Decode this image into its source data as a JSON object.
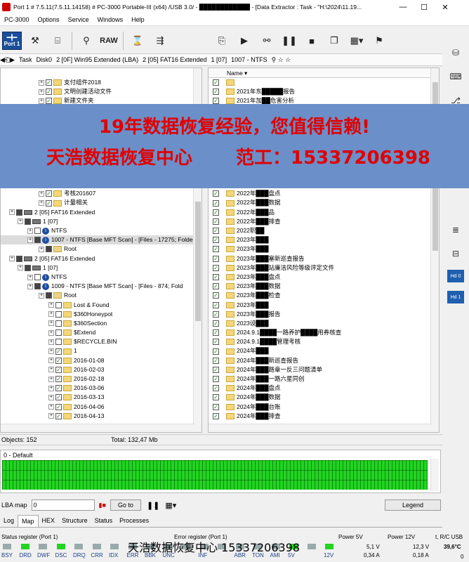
{
  "window": {
    "title": "Port 1 # 7.5.11(7.5.11.14158) # PC-3000 Portable-III (x64) /USB 3.0/ - ████████████ - [Data Extractor : Task - \"H:\\2024\\11.19...",
    "min": "—",
    "max": "☐",
    "close": "✕"
  },
  "menu": {
    "app": "PC-3000",
    "items": [
      "Options",
      "Service",
      "Windows",
      "Help"
    ]
  },
  "toolbar": {
    "port": "Port 1",
    "raw": "RAW"
  },
  "breadcrumb": {
    "task": "Task",
    "disk": "Disk0",
    "part1": "2 [0F] Win95 Extended  (LBA)",
    "part2": "2 [05] FAT16 Extended",
    "part3": "1 [07]",
    "part4": "1007 - NTFS"
  },
  "tree": [
    {
      "indent": 54,
      "cb": "check",
      "icon": "folder",
      "label": "支付组件2018"
    },
    {
      "indent": 54,
      "cb": "check",
      "icon": "folder",
      "label": "文明创建活动文件"
    },
    {
      "indent": 54,
      "cb": "check",
      "icon": "folder",
      "label": "新建文件夹"
    },
    {
      "indent": 54,
      "cb": "check",
      "icon": "folder",
      "label": ""
    },
    {
      "indent": 54,
      "cb": "check",
      "icon": "folder",
      "label": ""
    },
    {
      "indent": 54,
      "cb": "check",
      "icon": "folder",
      "label": ""
    },
    {
      "indent": 54,
      "cb": "check",
      "icon": "folder",
      "label": ""
    },
    {
      "indent": 54,
      "cb": "check",
      "icon": "folder",
      "label": ""
    },
    {
      "indent": 54,
      "cb": "check",
      "icon": "folder",
      "label": ""
    },
    {
      "indent": 54,
      "cb": "check",
      "icon": "folder",
      "label": ""
    },
    {
      "indent": 54,
      "cb": "check",
      "icon": "folder",
      "label": ""
    },
    {
      "indent": 54,
      "cb": "check",
      "icon": "folder",
      "label": ""
    },
    {
      "indent": 54,
      "cb": "check",
      "icon": "folder",
      "label": "考核201607"
    },
    {
      "indent": 54,
      "cb": "check",
      "icon": "folder",
      "label": "计量相关"
    },
    {
      "indent": 12,
      "cb": "part",
      "icon": "hdd",
      "label": "2 [05] FAT16 Extended"
    },
    {
      "indent": 24,
      "cb": "part",
      "icon": "hdd",
      "label": "1 [07]"
    },
    {
      "indent": 38,
      "cb": "none",
      "icon": "info",
      "label": "NTFS"
    },
    {
      "indent": 38,
      "cb": "part",
      "icon": "info",
      "label": "1007 - NTFS [Base MFT Scan] - [Files - 17275; Folde",
      "sel": true
    },
    {
      "indent": 54,
      "cb": "part",
      "icon": "root",
      "label": "Root"
    },
    {
      "indent": 12,
      "cb": "part",
      "icon": "hdd",
      "label": "2 [05] FAT16 Extended"
    },
    {
      "indent": 24,
      "cb": "part",
      "icon": "hdd",
      "label": "1 [07]"
    },
    {
      "indent": 38,
      "cb": "none",
      "icon": "info",
      "label": "NTFS"
    },
    {
      "indent": 38,
      "cb": "part",
      "icon": "info",
      "label": "1009 - NTFS [Base MFT Scan] - [Files - 874; Fold"
    },
    {
      "indent": 54,
      "cb": "part",
      "icon": "root",
      "label": "Root"
    },
    {
      "indent": 68,
      "cb": "none",
      "icon": "folder",
      "label": "Lost & Found"
    },
    {
      "indent": 68,
      "cb": "none",
      "icon": "folder",
      "label": "$360Honeypot"
    },
    {
      "indent": 68,
      "cb": "none",
      "icon": "folder",
      "label": "$360Section"
    },
    {
      "indent": 68,
      "cb": "none",
      "icon": "folder",
      "label": "$Extend"
    },
    {
      "indent": 68,
      "cb": "none",
      "icon": "folder",
      "label": "$RECYCLE.BIN"
    },
    {
      "indent": 68,
      "cb": "check",
      "icon": "folder",
      "label": "1"
    },
    {
      "indent": 68,
      "cb": "check",
      "icon": "folder",
      "label": "2016-01-08"
    },
    {
      "indent": 68,
      "cb": "check",
      "icon": "folder",
      "label": "2016-02-03"
    },
    {
      "indent": 68,
      "cb": "check",
      "icon": "folder",
      "label": "2016-02-18"
    },
    {
      "indent": 68,
      "cb": "check",
      "icon": "folder",
      "label": "2016-03-06"
    },
    {
      "indent": 68,
      "cb": "check",
      "icon": "folder",
      "label": "2016-03-13"
    },
    {
      "indent": 68,
      "cb": "check",
      "icon": "folder",
      "label": "2016-04-06"
    },
    {
      "indent": 68,
      "cb": "check",
      "icon": "folder",
      "label": "2016-04-13"
    }
  ],
  "list": {
    "header": "Name",
    "rows": [
      "",
      "2021年东█████报告",
      "2021年加██危害分析",
      "2021██",
      "",
      "",
      "",
      "",
      "",
      "",
      "",
      "",
      "2022年███盘点",
      "2022年███数据",
      "2022年███品",
      "2022年███排查",
      "2022职██",
      "2023年███",
      "2023年███",
      "2023年███塞新巡查报告",
      "2023年███站廉洁风险等级评定文件",
      "2023年███盘点",
      "2023年███数据",
      "2023年███检查",
      "2023年███",
      "2023年███报告",
      "2023设███",
      "2024.9.1████一路养护████用券核查",
      "2024.9.1████管理考核",
      "2024年███",
      "2024年███新巡查报告",
      "2024年███路章一反三问题清单",
      "2024年███一路六星同创",
      "2024年███盘点",
      "2024年███数据",
      "2024年███台账",
      "2024年███排查"
    ]
  },
  "status": {
    "objects": "Objects: 152",
    "total": "Total: 132,47 Mb"
  },
  "map": {
    "label": "0 - Default"
  },
  "lba": {
    "label": "LBA map",
    "value": "0",
    "goto": "Go to",
    "legend": "Legend"
  },
  "tabs": [
    "Log",
    "Map",
    "HEX",
    "Structure",
    "Status",
    "Processes"
  ],
  "statusbar": {
    "reg": "Status register (Port 1)",
    "err": "Error register (Port 1)",
    "p5": "Power 5V",
    "p12": "Power 12V",
    "usb": "t, R/C USB",
    "leds": [
      "BSY",
      "DRD",
      "DWF",
      "DSC",
      "DRQ",
      "CRR",
      "IDX",
      "ERR",
      "BBK",
      "UNC",
      "",
      "INF",
      "",
      "ABR",
      "TON",
      "AMI",
      "5V",
      "",
      "12V"
    ],
    "v5": "5,1 V",
    "a5": "0,34 A",
    "v12": "12,3 V",
    "a12": "0,18 A",
    "temp": "39,6°C",
    "zero": "0"
  },
  "banner": {
    "line1": "19年数据恢复经验，您值得信赖!",
    "line2a": "天浩数据恢复中心",
    "line2b": "范工：15337206398"
  },
  "watermark": "天浩数据恢复中心 15337206398"
}
